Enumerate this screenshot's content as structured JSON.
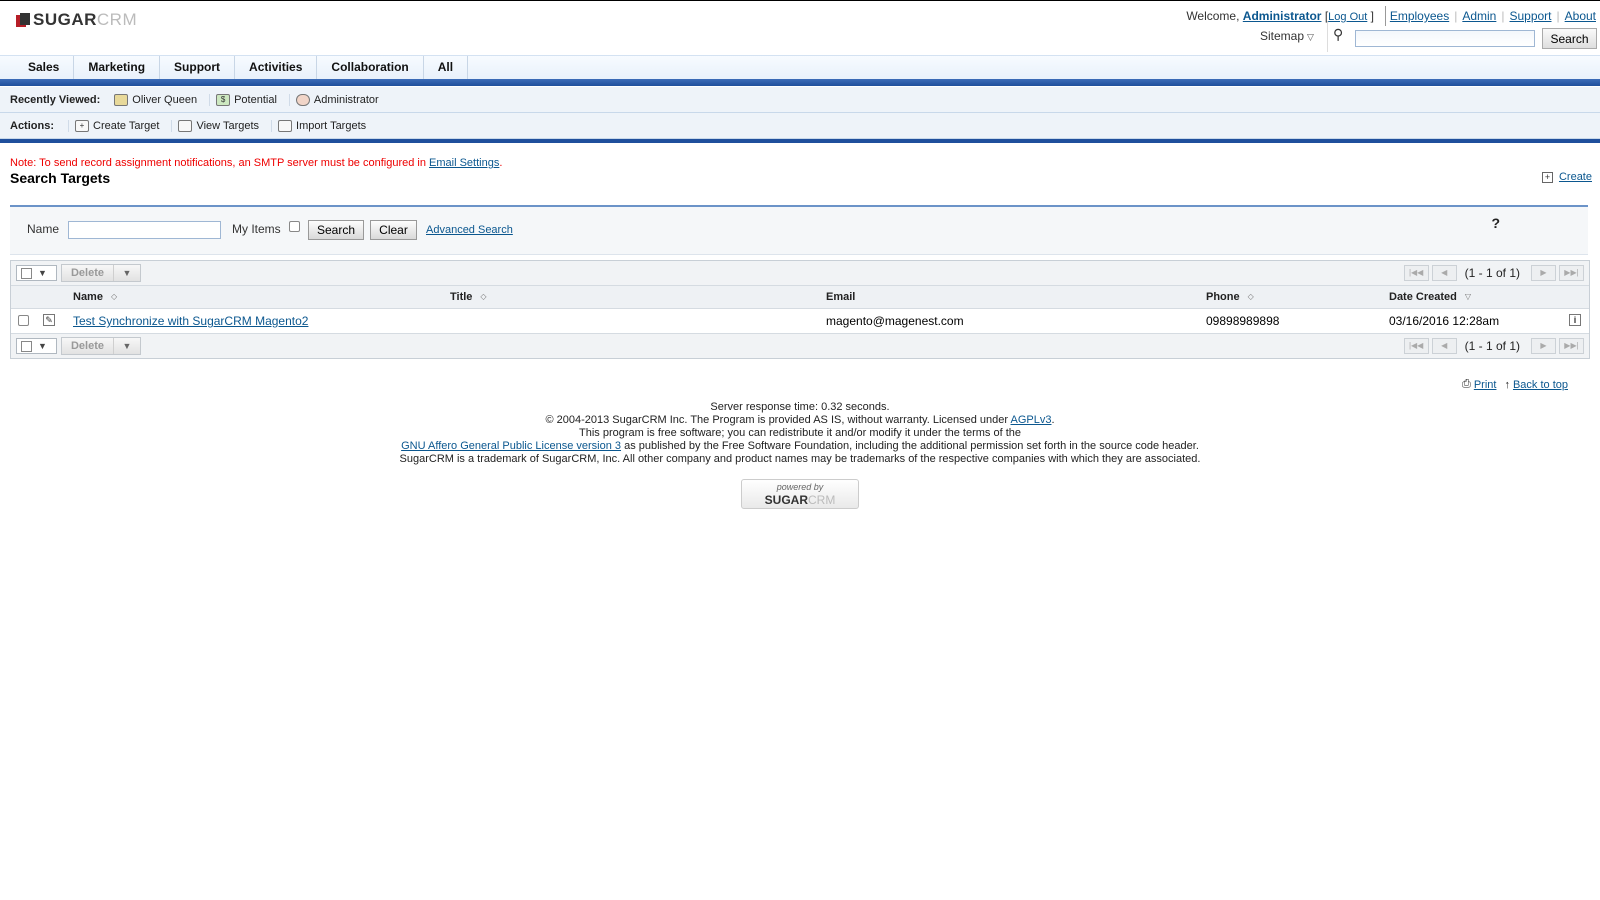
{
  "app": {
    "logo_text": "SUGAR",
    "logo_text_crm": "CRM"
  },
  "header": {
    "welcome_label": "Welcome,",
    "user_name": "Administrator",
    "logout_open": "[",
    "logout_label": "Log Out",
    "logout_close": "]",
    "utility_links": [
      "Employees",
      "Admin",
      "Support",
      "About"
    ],
    "sitemap_label": "Sitemap",
    "search_button_label": "Search",
    "search_placeholder": ""
  },
  "tabs": [
    "Sales",
    "Marketing",
    "Support",
    "Activities",
    "Collaboration",
    "All"
  ],
  "recently_viewed": {
    "label": "Recently Viewed:",
    "items": [
      "Oliver Queen",
      "Potential",
      "Administrator"
    ]
  },
  "actions": {
    "label": "Actions:",
    "items": [
      "Create Target",
      "View Targets",
      "Import Targets"
    ]
  },
  "note": {
    "text": "Note: To send record assignment notifications, an SMTP server must be configured in ",
    "link": "Email Settings",
    "end": "."
  },
  "page": {
    "title": "Search Targets",
    "create_label": "Create"
  },
  "search_form": {
    "name_label": "Name",
    "name_value": "",
    "my_items_label": "My Items",
    "search_label": "Search",
    "clear_label": "Clear",
    "advanced_label": "Advanced Search",
    "help_label": "?"
  },
  "list": {
    "delete_label": "Delete",
    "pagination": "(1 - 1 of 1)",
    "columns": [
      "Name",
      "Title",
      "Email",
      "Phone",
      "Date Created"
    ],
    "rows": [
      {
        "name": "Test Synchronize with SugarCRM Magento2",
        "title": "",
        "email": "magento@magenest.com",
        "phone": "09898989898",
        "date_created": "03/16/2016 12:28am"
      }
    ]
  },
  "page_links": {
    "print": "Print",
    "back_to_top": "Back to top"
  },
  "footer": {
    "line1": "Server response time: 0.32 seconds.",
    "line2_text": "© 2004-2013 SugarCRM Inc. The Program is provided AS IS, without warranty. Licensed under ",
    "line2_link": "AGPLv3",
    "line2_end": ".",
    "line3": "This program is free software; you can redistribute it and/or modify it under the terms of the",
    "line4_link": "GNU Affero General Public License version 3",
    "line4_text": " as published by the Free Software Foundation, including the additional permission set forth in the source code header.",
    "line5": "SugarCRM is a trademark of SugarCRM, Inc. All other company and product names may be trademarks of the respective companies with which they are associated.",
    "powered_by": "powered by",
    "powered_brand": "SUGAR",
    "powered_brand_crm": "CRM"
  }
}
